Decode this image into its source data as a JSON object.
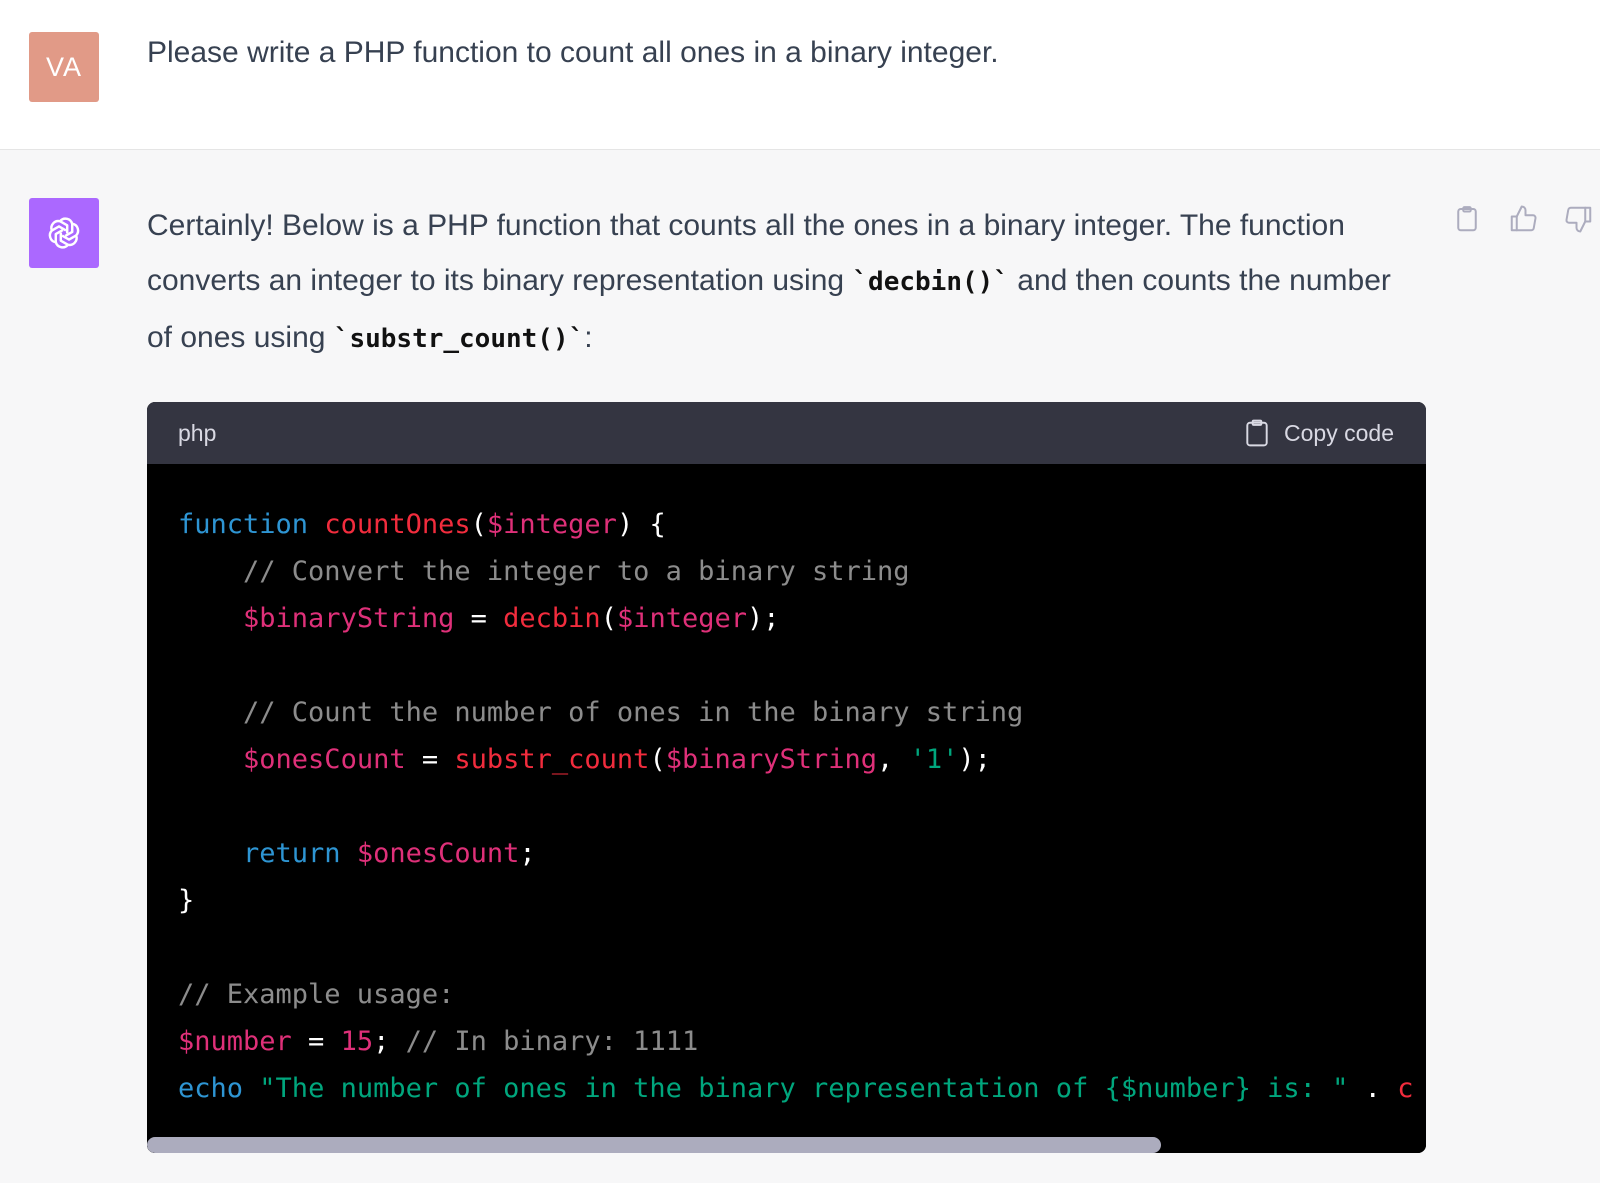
{
  "user_message": {
    "avatar_initials": "VA",
    "text": "Please write a PHP function to count all ones in a binary integer."
  },
  "assistant_message": {
    "avatar_icon": "openai-logo-icon",
    "intro": {
      "part1": "Certainly! Below is a PHP function that counts all the ones in a binary integer. The function converts an integer to its binary representation using ",
      "code1": "`decbin()`",
      "part2": " and then counts the number of ones using ",
      "code2": "`substr_count()`",
      "part3": ":"
    },
    "action_icons": [
      "clipboard-icon",
      "thumbs-up-icon",
      "thumbs-down-icon"
    ]
  },
  "code_block": {
    "language": "php",
    "copy_label": "Copy code",
    "lines": [
      [
        {
          "t": "kw",
          "v": "function"
        },
        {
          "t": "pl",
          "v": " "
        },
        {
          "t": "fn",
          "v": "countOnes"
        },
        {
          "t": "pl",
          "v": "("
        },
        {
          "t": "var",
          "v": "$integer"
        },
        {
          "t": "pl",
          "v": ") {"
        }
      ],
      [
        {
          "t": "pl",
          "v": "    "
        },
        {
          "t": "cm",
          "v": "// Convert the integer to a binary string"
        }
      ],
      [
        {
          "t": "pl",
          "v": "    "
        },
        {
          "t": "var",
          "v": "$binaryString"
        },
        {
          "t": "pl",
          "v": " = "
        },
        {
          "t": "fn",
          "v": "decbin"
        },
        {
          "t": "pl",
          "v": "("
        },
        {
          "t": "var",
          "v": "$integer"
        },
        {
          "t": "pl",
          "v": ");"
        }
      ],
      [],
      [
        {
          "t": "pl",
          "v": "    "
        },
        {
          "t": "cm",
          "v": "// Count the number of ones in the binary string"
        }
      ],
      [
        {
          "t": "pl",
          "v": "    "
        },
        {
          "t": "var",
          "v": "$onesCount"
        },
        {
          "t": "pl",
          "v": " = "
        },
        {
          "t": "fn",
          "v": "substr_count"
        },
        {
          "t": "pl",
          "v": "("
        },
        {
          "t": "var",
          "v": "$binaryString"
        },
        {
          "t": "pl",
          "v": ", "
        },
        {
          "t": "str",
          "v": "'1'"
        },
        {
          "t": "pl",
          "v": ");"
        }
      ],
      [],
      [
        {
          "t": "pl",
          "v": "    "
        },
        {
          "t": "kw",
          "v": "return"
        },
        {
          "t": "pl",
          "v": " "
        },
        {
          "t": "var",
          "v": "$onesCount"
        },
        {
          "t": "pl",
          "v": ";"
        }
      ],
      [
        {
          "t": "pl",
          "v": "}"
        }
      ],
      [],
      [
        {
          "t": "cm",
          "v": "// Example usage:"
        }
      ],
      [
        {
          "t": "var",
          "v": "$number"
        },
        {
          "t": "pl",
          "v": " = "
        },
        {
          "t": "num",
          "v": "15"
        },
        {
          "t": "pl",
          "v": "; "
        },
        {
          "t": "cm",
          "v": "// In binary: 1111"
        }
      ],
      [
        {
          "t": "kw",
          "v": "echo"
        },
        {
          "t": "pl",
          "v": " "
        },
        {
          "t": "str",
          "v": "\"The number of ones in the binary representation of {$number} is: \""
        },
        {
          "t": "pl",
          "v": " . "
        },
        {
          "t": "fn",
          "v": "c"
        }
      ]
    ]
  }
}
